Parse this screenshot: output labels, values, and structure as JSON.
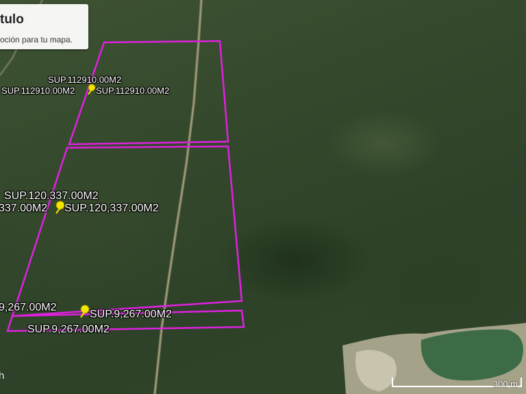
{
  "title_card": {
    "title": "tulo",
    "description": "oción para tu mapa."
  },
  "placemarks": [
    {
      "name": "parcel-north",
      "labels": [
        "SUP.112910.00M2",
        "SUP.112910.00M2",
        "SUP.112910.00M2"
      ]
    },
    {
      "name": "parcel-middle",
      "labels": [
        "SUP.120.337.00M2",
        "337.00M2",
        "SUP.120,337.00M2"
      ]
    },
    {
      "name": "parcel-south-strip",
      "labels": [
        "9,267.00M2",
        "SUP.9,267.00M2",
        "SUP.9,267.00M2"
      ]
    }
  ],
  "corner_text": "h",
  "scale": {
    "label": "300 m"
  },
  "colors": {
    "boundary": "#e020e0",
    "pin": "#f2e600",
    "label_text": "#ffffff",
    "forest": "#34482c",
    "lagoon": "#3d6b45"
  }
}
